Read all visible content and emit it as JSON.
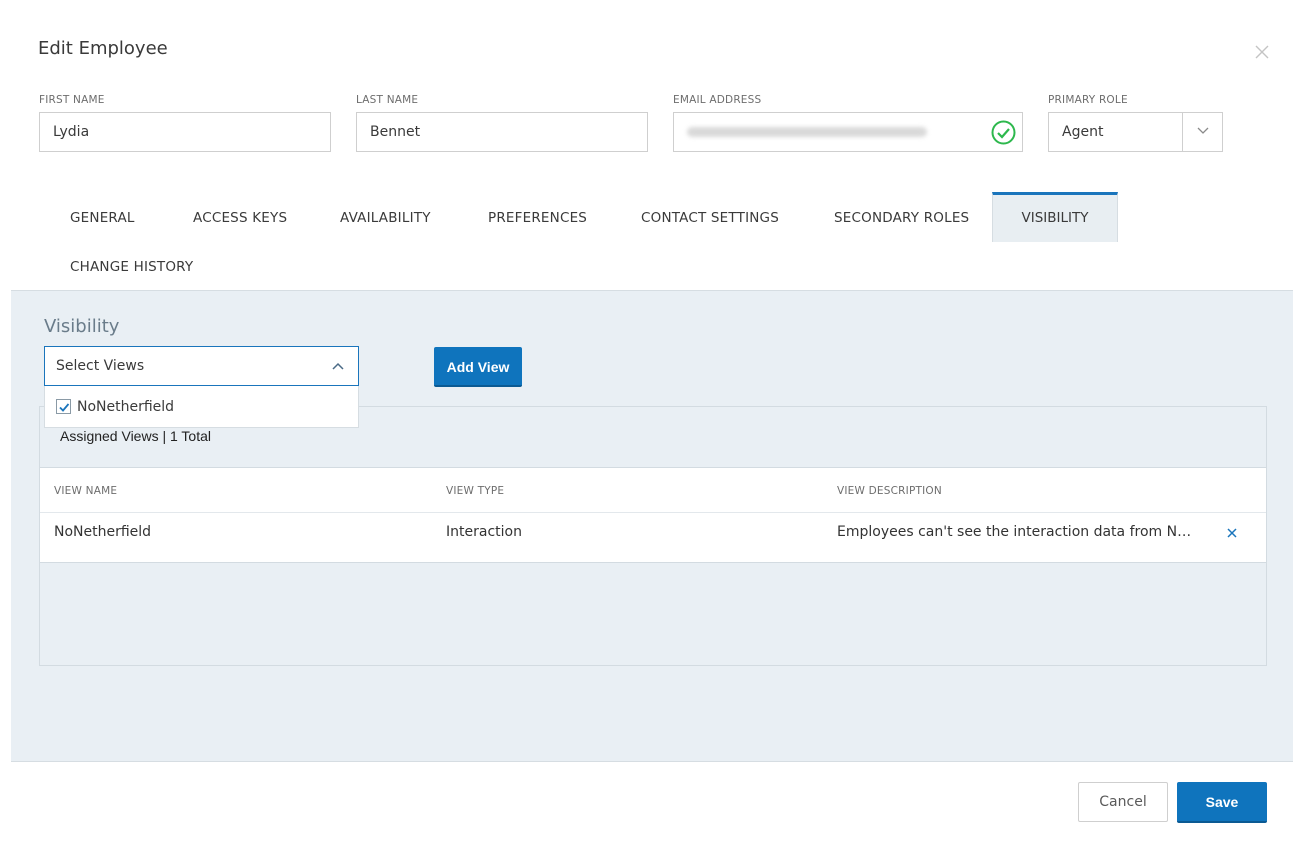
{
  "dialog": {
    "title": "Edit Employee"
  },
  "fields": {
    "first_name": {
      "label": "FIRST NAME",
      "value": "Lydia"
    },
    "last_name": {
      "label": "LAST NAME",
      "value": "Bennet"
    },
    "email": {
      "label": "EMAIL ADDRESS",
      "value": ""
    },
    "primary_role": {
      "label": "PRIMARY ROLE",
      "value": "Agent"
    }
  },
  "tabs": [
    {
      "label": "GENERAL"
    },
    {
      "label": "ACCESS KEYS"
    },
    {
      "label": "AVAILABILITY"
    },
    {
      "label": "PREFERENCES"
    },
    {
      "label": "CONTACT SETTINGS"
    },
    {
      "label": "SECONDARY ROLES"
    },
    {
      "label": "VISIBILITY",
      "active": true
    },
    {
      "label": "CHANGE HISTORY"
    }
  ],
  "visibility": {
    "heading": "Visibility",
    "select_placeholder": "Select Views",
    "dropdown_options": [
      {
        "label": "NoNetherfield",
        "checked": true
      }
    ],
    "add_button": "Add View",
    "assigned_title": "Assigned Views | 1 Total",
    "columns": [
      "VIEW NAME",
      "VIEW TYPE",
      "VIEW DESCRIPTION"
    ],
    "rows": [
      {
        "name": "NoNetherfield",
        "type": "Interaction",
        "description": "Employees can't see the interaction data from Netherfield"
      }
    ]
  },
  "footer": {
    "cancel": "Cancel",
    "save": "Save"
  },
  "colors": {
    "accent": "#0f74bd",
    "success": "#2db84d",
    "panel": "#e9eff4"
  }
}
